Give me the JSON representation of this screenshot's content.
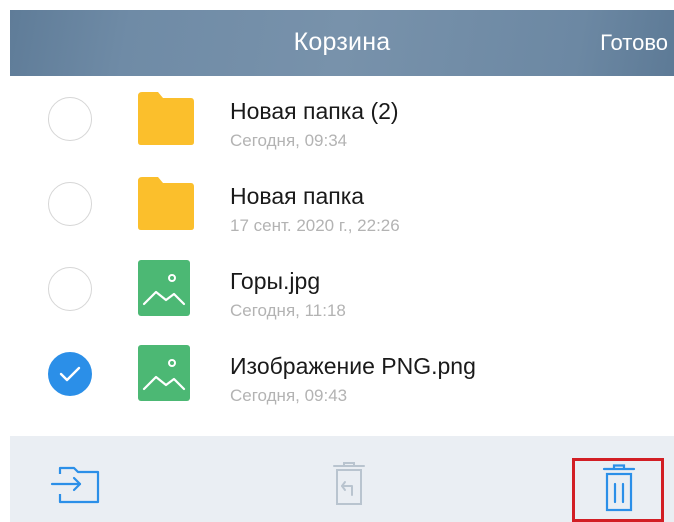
{
  "header": {
    "title": "Корзина",
    "done_label": "Готово"
  },
  "files": [
    {
      "name": "Новая папка (2)",
      "date": "Сегодня, 09:34",
      "type": "folder-icon",
      "selected": false
    },
    {
      "name": "Новая папка",
      "date": "17 сент. 2020 г., 22:26",
      "type": "folder-icon",
      "selected": false
    },
    {
      "name": "Горы.jpg",
      "date": "Сегодня, 11:18",
      "type": "image-icon",
      "selected": false
    },
    {
      "name": "Изображение PNG.png",
      "date": "Сегодня, 09:43",
      "type": "image-icon",
      "selected": true
    }
  ],
  "toolbar": {
    "items": [
      "move-to-folder-icon",
      "restore-icon",
      "delete-icon"
    ]
  },
  "colors": {
    "header": "#7090aa",
    "accent": "#2b8fe8",
    "folder": "#fbbf2c",
    "image": "#4cb874",
    "highlight": "#d21e24"
  }
}
